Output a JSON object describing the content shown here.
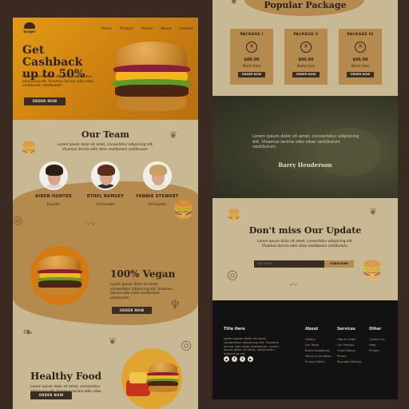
{
  "colors": {
    "hero_orange": "#e39a14",
    "tan": "#c9b894",
    "brown": "#b58a4e",
    "dark_button": "#3a2e24",
    "footer_black": "#121212",
    "page_bg": "#3a2a22"
  },
  "left": {
    "logo_text": "burger",
    "nav": [
      "Home",
      "Product",
      "Promo",
      "About",
      "Contact"
    ],
    "hero": {
      "title": "Get Cashback up to 50%",
      "text": "Lorem ipsum dolor sit amet, consectetur adipiscing elit. Vivamus lacinia odio vitae vestibulum vestibulum.",
      "button": "ORDER NOW"
    },
    "team": {
      "title": "Our Team",
      "text": "Lorem ipsum dolor sit amet, consectetur adipiscing elit. Vivamus lacinia odio vitae vestibulum vestibulum.",
      "members": [
        {
          "name": "AIDEN HUNTER",
          "role": "Founder"
        },
        {
          "name": "ETHEL RAMSEY",
          "role": "Co-Founder"
        },
        {
          "name": "FANNIE STEWART",
          "role": "Co-Founder"
        }
      ]
    },
    "vegan": {
      "title": "100% Vegan",
      "text": "Lorem ipsum dolor sit amet, consectetur adipiscing elit. Vivamus lacinia odio vitae vestibulum vestibulum.",
      "button": "ORDER NOW"
    },
    "healthy": {
      "title": "Healthy Food",
      "text": "Lorem ipsum dolor sit amet, consectetur adipiscing elit. Vivamus lacinia odio vitae vestibulum vestibulum.",
      "button": "ORDER NOW"
    }
  },
  "right": {
    "packages": {
      "title": "Popular Package",
      "items": [
        {
          "title": "PACKAGE I",
          "price": "$00.00",
          "sub": "Starts from",
          "button": "ORDER NOW"
        },
        {
          "title": "PACKAGE II",
          "price": "$00.00",
          "sub": "Starts from",
          "button": "ORDER NOW"
        },
        {
          "title": "PACKAGE III",
          "price": "$00.00",
          "sub": "Starts from",
          "button": "ORDER NOW"
        }
      ]
    },
    "testimonial": {
      "quote": "Lorem ipsum dolor sit amet, consectetur adipiscing elit. Vivamus lacinia odio vitae vestibulum vestibulum.",
      "name": "Barry Henderson"
    },
    "update": {
      "title": "Don't miss Our Update",
      "text": "Lorem ipsum dolor sit amet, consectetur adipiscing elit. Vivamus lacinia odio vitae vestibulum vestibulum.",
      "email_placeholder": "Your Email",
      "subscribe": "SUBSCRIBE"
    },
    "footer": {
      "title": "Title Here",
      "text": "Lorem ipsum dolor sit amet, consectetur adipiscing elit. Vivamus lacinia odio vitae vestibulum. Lorem ipsum dolor sit amet, consectetur adipiscing elit.",
      "social": [
        "ig-icon",
        "fb-icon",
        "tw-icon",
        "yt-icon"
      ],
      "columns": [
        {
          "title": "About",
          "links": [
            "History",
            "Our Team",
            "Brand Guidelines",
            "Terms & Condition",
            "Privacy Policy"
          ]
        },
        {
          "title": "Services",
          "links": [
            "How to Order",
            "Our Product",
            "Order Status",
            "Promo",
            "Payment Method"
          ]
        },
        {
          "title": "Other",
          "links": [
            "Contact Us",
            "Help",
            "Privacy"
          ]
        }
      ]
    }
  }
}
